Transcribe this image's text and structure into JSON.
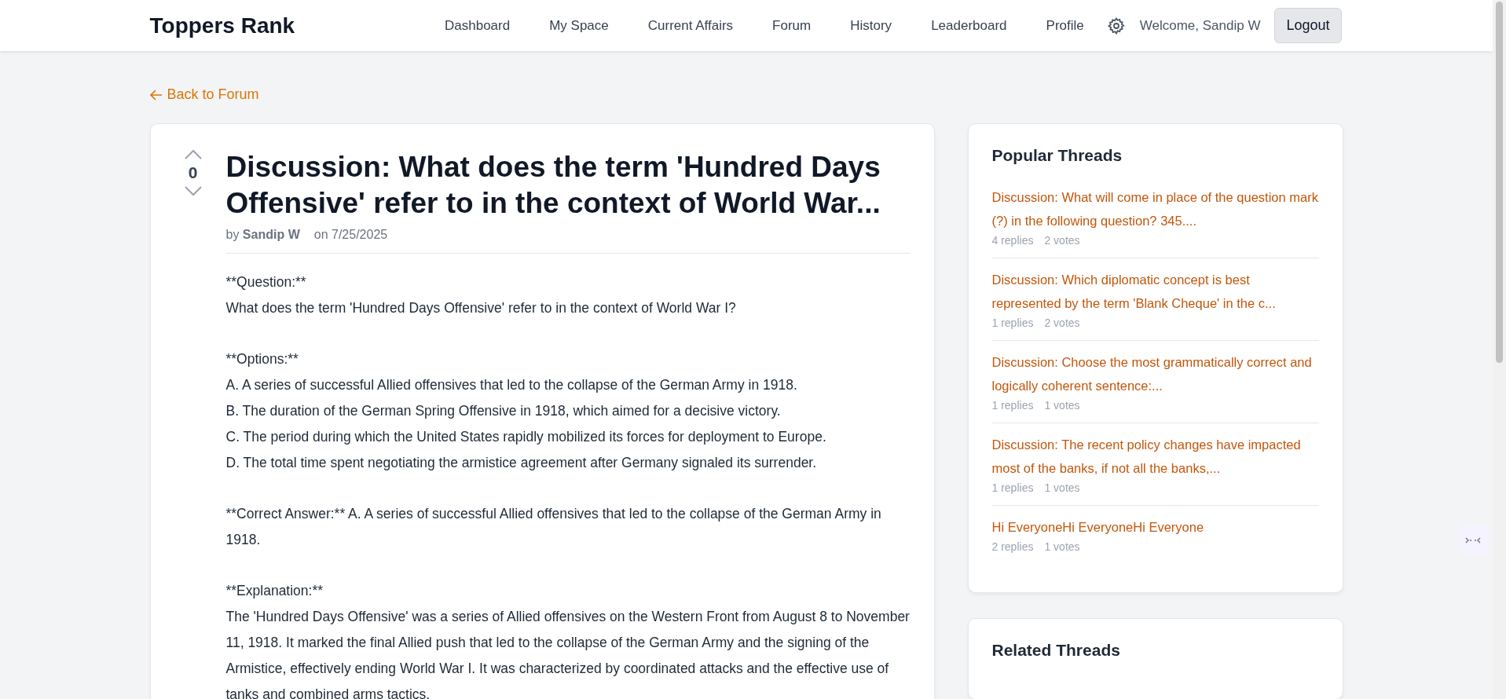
{
  "header": {
    "logo": "Toppers Rank",
    "nav": [
      {
        "label": "Dashboard"
      },
      {
        "label": "My Space"
      },
      {
        "label": "Current Affairs"
      },
      {
        "label": "Forum"
      },
      {
        "label": "History"
      },
      {
        "label": "Leaderboard"
      },
      {
        "label": "Profile"
      }
    ],
    "welcome": "Welcome, Sandip W",
    "logout": "Logout"
  },
  "back_link": "Back to Forum",
  "post": {
    "votes": "0",
    "title": "Discussion: What does the term 'Hundred Days Offensive' refer to in the context of World War...",
    "by": "by",
    "author": "Sandip W",
    "date": "on 7/25/2025",
    "paragraphs": [
      [
        "**Question:**",
        "What does the term 'Hundred Days Offensive' refer to in the context of World War I?"
      ],
      [
        "**Options:**",
        "A. A series of successful Allied offensives that led to the collapse of the German Army in 1918.",
        "B. The duration of the German Spring Offensive in 1918, which aimed for a decisive victory.",
        "C. The period during which the United States rapidly mobilized its forces for deployment to Europe.",
        "D. The total time spent negotiating the armistice agreement after Germany signaled its surrender."
      ],
      [
        "**Correct Answer:** A. A series of successful Allied offensives that led to the collapse of the German Army in 1918."
      ],
      [
        "**Explanation:**",
        "The 'Hundred Days Offensive' was a series of Allied offensives on the Western Front from August 8 to November 11, 1918. It marked the final Allied push that led to the collapse of the German Army and the signing of the Armistice, effectively ending World War I. It was characterized by coordinated attacks and the effective use of tanks and combined arms tactics."
      ]
    ]
  },
  "popular_threads": {
    "title": "Popular Threads",
    "items": [
      {
        "title": "Discussion: What will come in place of the question mark (?) in the following question? 345....",
        "replies": "4 replies",
        "votes": "2 votes"
      },
      {
        "title": "Discussion: Which diplomatic concept is best represented by the term 'Blank Cheque' in the c...",
        "replies": "1 replies",
        "votes": "2 votes"
      },
      {
        "title": "Discussion: Choose the most grammatically correct and logically coherent sentence:...",
        "replies": "1 replies",
        "votes": "1 votes"
      },
      {
        "title": "Discussion: The recent policy changes have impacted most of the banks, if not all the banks,...",
        "replies": "1 replies",
        "votes": "1 votes"
      },
      {
        "title": "Hi EveryoneHi EveryoneHi Everyone",
        "replies": "2 replies",
        "votes": "1 votes"
      }
    ]
  },
  "related_threads": {
    "title": "Related Threads"
  }
}
